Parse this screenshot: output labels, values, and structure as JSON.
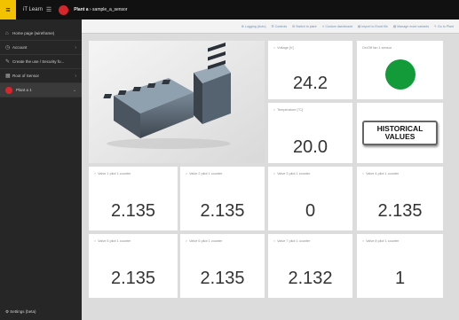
{
  "topbar": {
    "logo": "≡",
    "app_name": "iT Learn",
    "menu_glyph": "☰",
    "breadcrumb_root": "Plant a",
    "breadcrumb_path": "› sample_a_sensor"
  },
  "sidebar": {
    "items": [
      {
        "icon": "⌂",
        "label": "Home page (wireframe)",
        "chevron": ""
      },
      {
        "icon": "◷",
        "label": "Account",
        "chevron": "›"
      },
      {
        "icon": "✎",
        "label": "Create the use / Security fo...",
        "chevron": ""
      },
      {
        "icon": "▦",
        "label": "Root of Sensor",
        "chevron": "›"
      },
      {
        "icon": "",
        "label": "Plant a 1",
        "chevron": "⌄"
      }
    ],
    "bottom_label": "⚙ Settings (beta)"
  },
  "toolbar": {
    "items": [
      "⚙ Logging (Auto)",
      "☰ Controls",
      "⊞ Switch to plant",
      "≺ Custom dashboard",
      "▤ Import to Excel file",
      "▤ Manage more variants",
      "✎ Go to Plant"
    ]
  },
  "cards": {
    "voltage": {
      "label": "Voltage [V]",
      "value": "24.2"
    },
    "onoff": {
      "label": "On/Off fan 1 sensor",
      "status_color": "#139b3a"
    },
    "temperature": {
      "label": "Temperature [°C]",
      "value": "20.0"
    },
    "historical": {
      "label": "HISTORICAL\nVALUES"
    },
    "row1": [
      {
        "label": "Valve 1 pilot 1 counter",
        "value": "2.135"
      },
      {
        "label": "Valve 2 pilot 1 counter",
        "value": "2.135"
      },
      {
        "label": "Valve 3 pilot 1 counter",
        "value": "0"
      },
      {
        "label": "Valve 4 pilot 1 counter",
        "value": "2.135"
      }
    ],
    "row2": [
      {
        "label": "Valve 5 pilot 1 counter",
        "value": "2.135"
      },
      {
        "label": "Valve 6 pilot 1 counter",
        "value": "2.135"
      },
      {
        "label": "Valve 7 pilot 1 counter",
        "value": "2.132"
      },
      {
        "label": "Valve 8 pilot 1 counter",
        "value": "1"
      }
    ]
  }
}
